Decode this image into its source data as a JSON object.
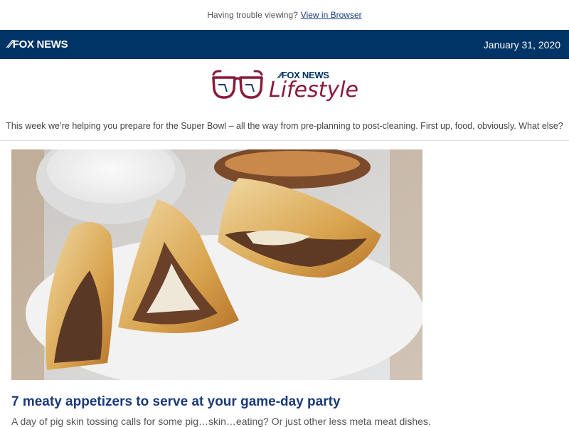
{
  "top_bar": {
    "prompt": "Having trouble viewing?",
    "link": "View in Browser"
  },
  "nav": {
    "brand": "FOX NEWS",
    "date": "January 31, 2020"
  },
  "header": {
    "brand_small": "FOX NEWS",
    "section": "Lifestyle"
  },
  "intro": "This week we’re helping you prepare for the Super Bowl – all the way from pre-planning to post-cleaning. First up, food, obviously. What else?",
  "article": {
    "headline": "7 meaty appetizers to serve at your game-day party",
    "summary": "A day of pig skin tossing calls for some pig…skin…eating? Or just other less meta meat dishes."
  },
  "colors": {
    "nav_bg": "#003366",
    "headline": "#1a3a7a",
    "lifestyle": "#8b1a3a"
  }
}
